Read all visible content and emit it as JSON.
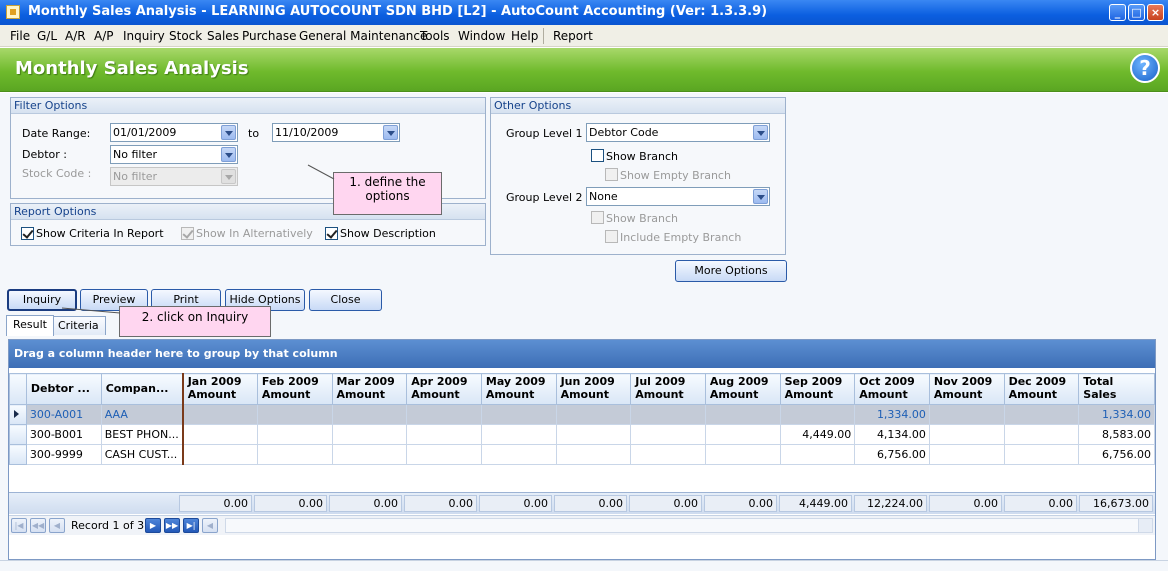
{
  "window": {
    "title": "Monthly Sales Analysis - LEARNING AUTOCOUNT SDN BHD [L2] - AutoCount Accounting (Ver: 1.3.3.9)",
    "min_glyph": "_",
    "max_glyph": "□",
    "close_glyph": "×"
  },
  "menu": {
    "items": [
      "File",
      "G/L",
      "A/R",
      "A/P",
      "Inquiry",
      "Stock",
      "Sales",
      "Purchase",
      "General Maintenance",
      "Tools",
      "Window",
      "Help",
      "Report"
    ]
  },
  "header": {
    "title": "Monthly Sales Analysis",
    "help_glyph": "?"
  },
  "filter_options": {
    "title": "Filter Options",
    "date_range_label": "Date Range:",
    "date_from": "01/01/2009",
    "to_label": "to",
    "date_to": "11/10/2009",
    "debtor_label": "Debtor :",
    "debtor_value": "No filter",
    "stock_code_label": "Stock Code :",
    "stock_code_value": "No filter"
  },
  "report_options": {
    "title": "Report Options",
    "show_criteria": "Show Criteria In Report",
    "show_in_alternatively": "Show In Alternatively",
    "show_description": "Show Description"
  },
  "other_options": {
    "title": "Other Options",
    "group_level_1_label": "Group Level 1 :",
    "group_level_1_value": "Debtor Code",
    "show_branch_1": "Show Branch",
    "show_empty_branch": "Show Empty Branch",
    "group_level_2_label": "Group Level 2 :",
    "group_level_2_value": "None",
    "show_branch_2": "Show Branch",
    "include_empty_branch": "Include Empty Branch"
  },
  "buttons": {
    "more_options": "More Options",
    "inquiry": "Inquiry",
    "preview": "Preview",
    "print": "Print",
    "hide_options": "Hide Options",
    "close": "Close"
  },
  "callouts": {
    "define": "1. define the options",
    "click": "2. click on Inquiry"
  },
  "tabs": [
    "Result",
    "Criteria"
  ],
  "grid": {
    "group_panel_text": "Drag a column header here to group by that column",
    "columns": [
      "Debtor ...",
      "Compan...",
      "Jan 2009 Amount",
      "Feb 2009 Amount",
      "Mar 2009 Amount",
      "Apr 2009 Amount",
      "May 2009 Amount",
      "Jun 2009 Amount",
      "Jul 2009 Amount",
      "Aug 2009 Amount",
      "Sep 2009 Amount",
      "Oct 2009 Amount",
      "Nov 2009 Amount",
      "Dec 2009 Amount",
      "Total Sales"
    ],
    "rows": [
      [
        "300-A001",
        "AAA",
        "",
        "",
        "",
        "",
        "",
        "",
        "",
        "",
        "",
        "1,334.00",
        "",
        "",
        "1,334.00"
      ],
      [
        "300-B001",
        "BEST PHON...",
        "",
        "",
        "",
        "",
        "",
        "",
        "",
        "",
        "4,449.00",
        "4,134.00",
        "",
        "",
        "8,583.00"
      ],
      [
        "300-9999",
        "CASH CUST...",
        "",
        "",
        "",
        "",
        "",
        "",
        "",
        "",
        "",
        "6,756.00",
        "",
        "",
        "6,756.00"
      ]
    ],
    "totals": [
      "0.00",
      "0.00",
      "0.00",
      "0.00",
      "0.00",
      "0.00",
      "0.00",
      "0.00",
      "4,449.00",
      "12,224.00",
      "0.00",
      "0.00",
      "16,673.00"
    ],
    "record_text": "Record 1 of 3"
  }
}
